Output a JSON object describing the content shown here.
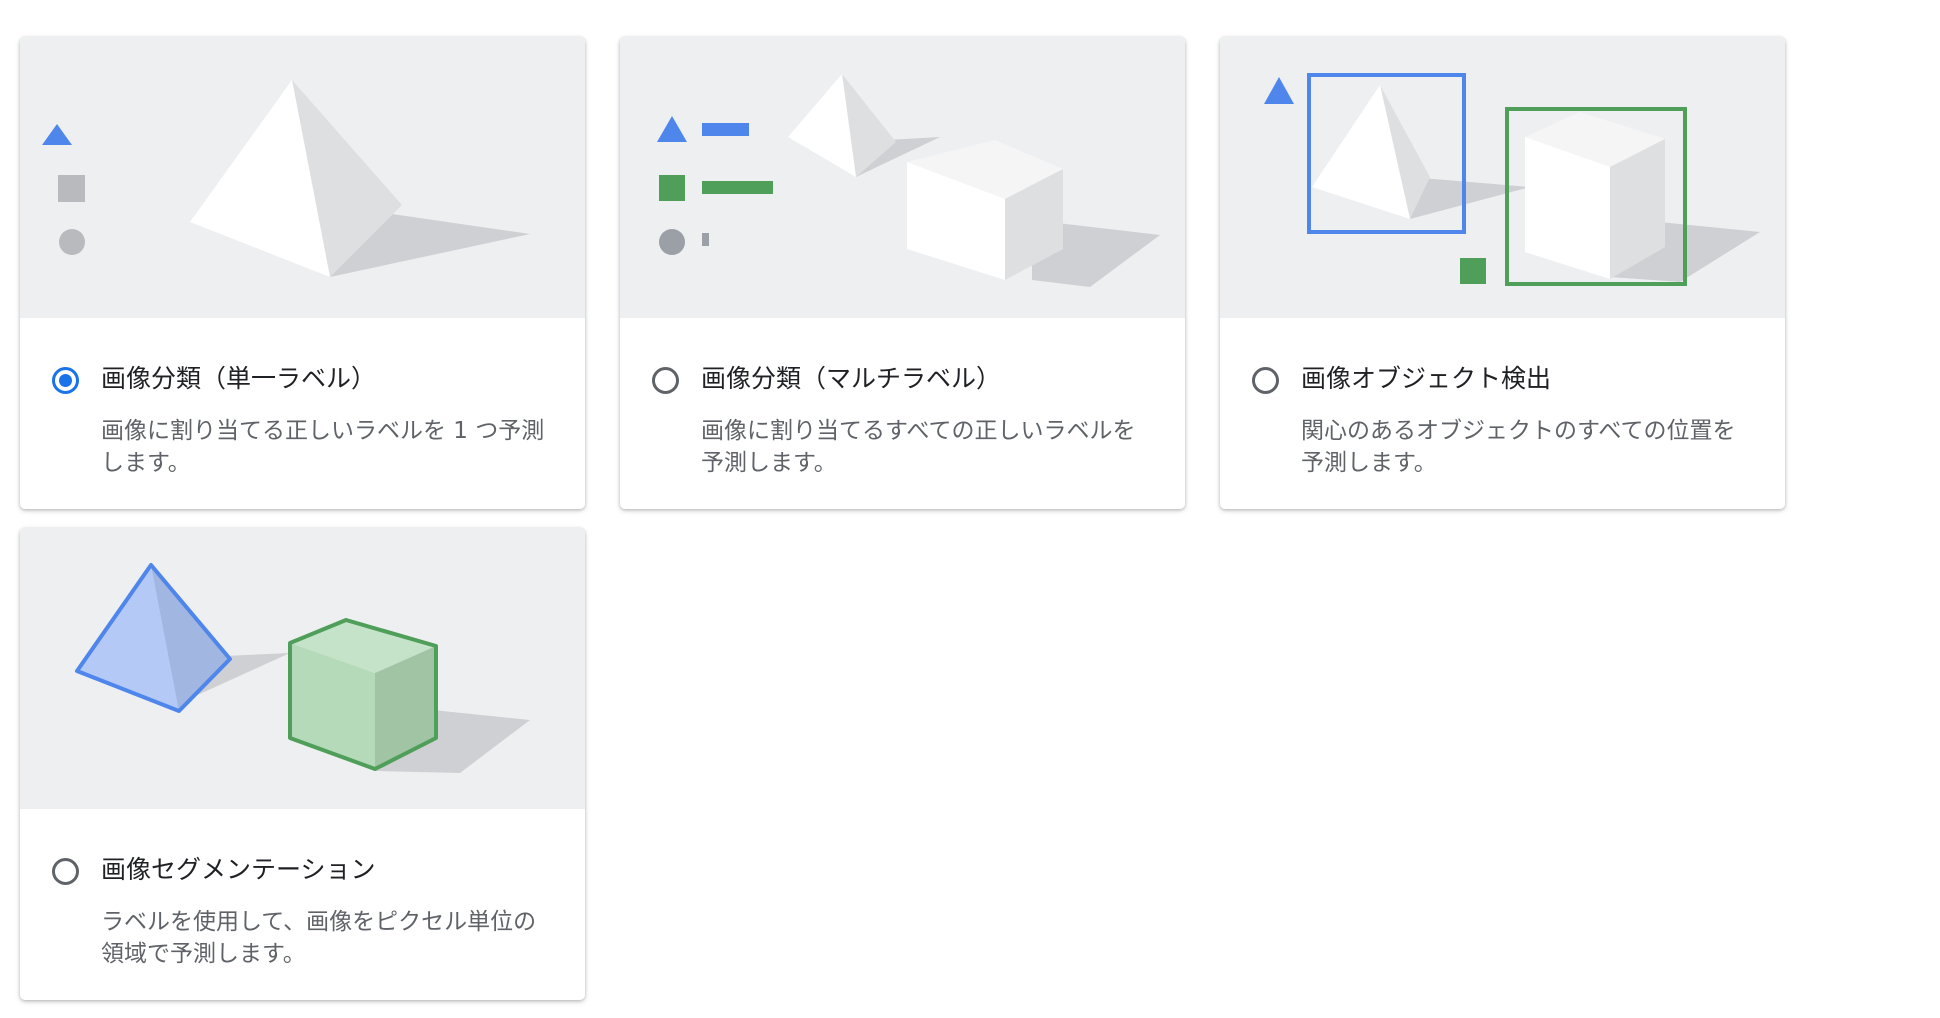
{
  "colors": {
    "accent_blue": "#1a73e8",
    "shape_blue": "#4f86ec",
    "shape_green": "#4f9e5a",
    "illustration_bg": "#eeeff1",
    "title_text": "#202124",
    "desc_text": "#5f6368"
  },
  "options": [
    {
      "title": "画像分類（単一ラベル）",
      "description": "画像に割り当てる正しいラベルを 1 つ予測します。",
      "selected": true,
      "illustration": "single-label-pyramid"
    },
    {
      "title": "画像分類（マルチラベル）",
      "description": "画像に割り当てるすべての正しいラベルを予測します。",
      "selected": false,
      "illustration": "multi-label-pyramid-cube"
    },
    {
      "title": "画像オブジェクト検出",
      "description": "関心のあるオブジェクトのすべての位置を予測します。",
      "selected": false,
      "illustration": "object-detection-boxes"
    },
    {
      "title": "画像セグメンテーション",
      "description": "ラベルを使用して、画像をピクセル単位の領域で予測します。",
      "selected": false,
      "illustration": "segmentation-colored-shapes"
    }
  ]
}
